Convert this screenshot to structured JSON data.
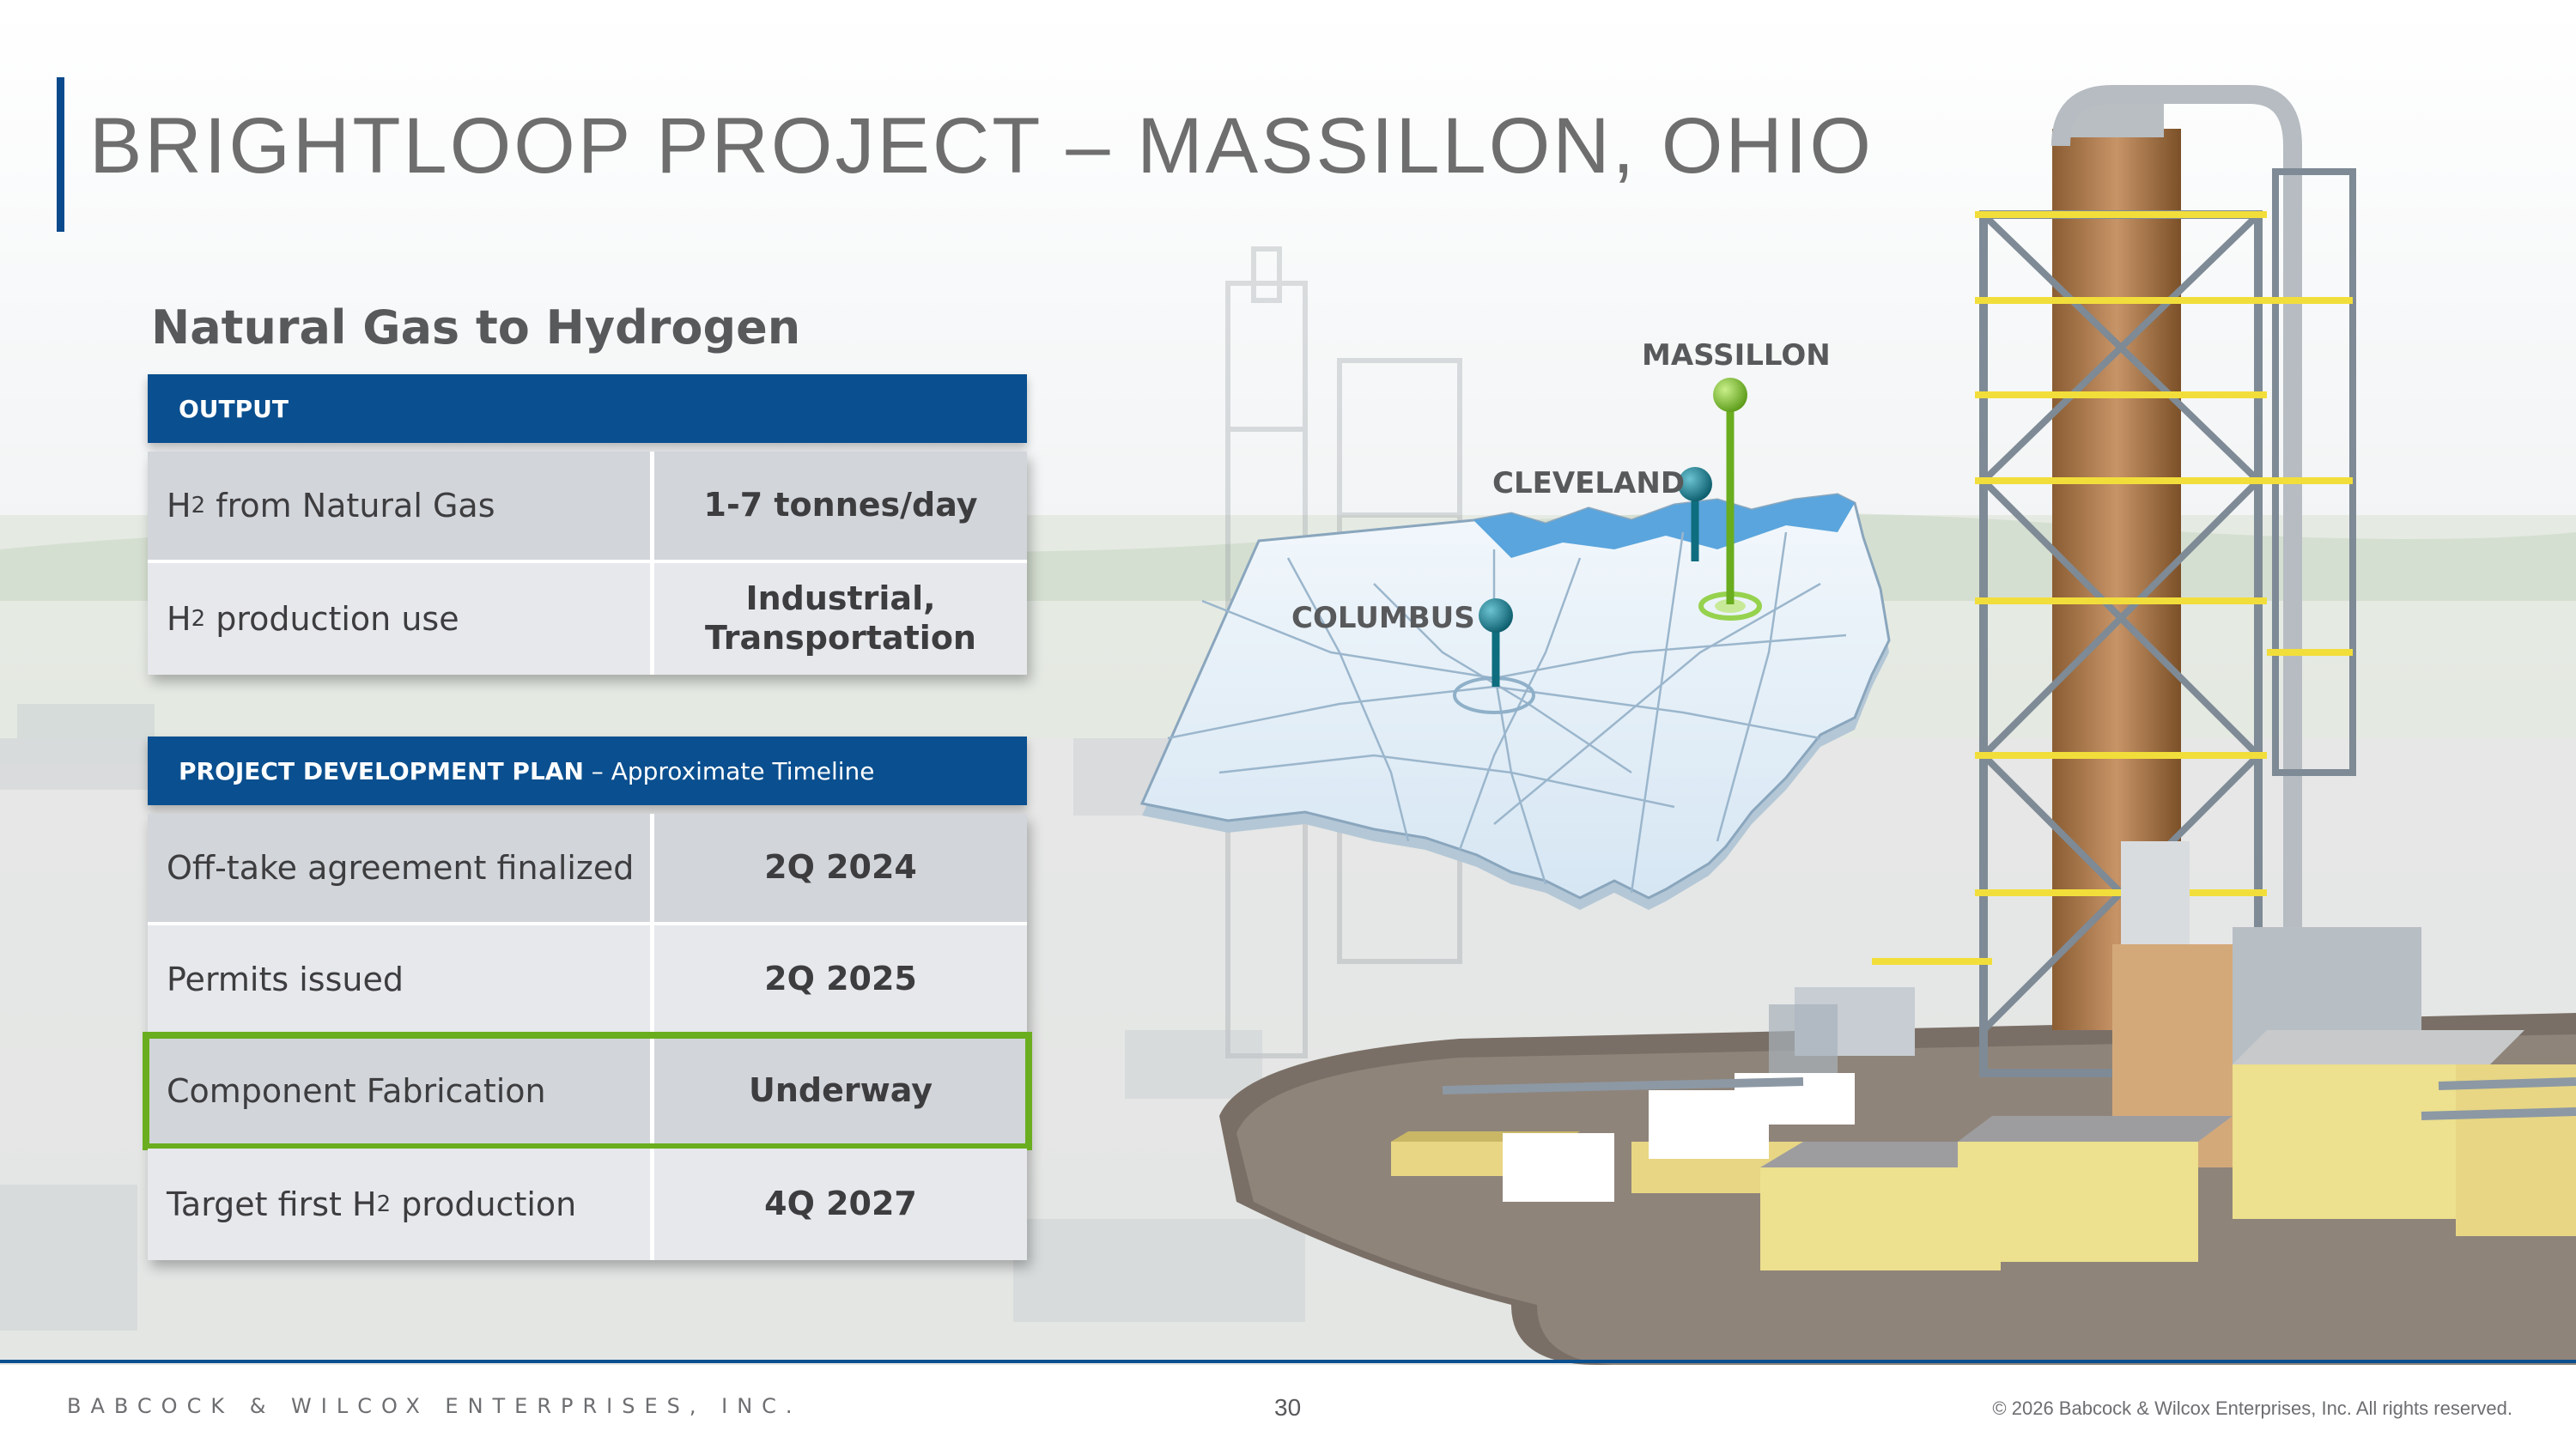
{
  "title": "BRIGHTLOOP PROJECT – MASSILLON, OHIO",
  "subtitle": "Natural Gas to Hydrogen",
  "output_table": {
    "header": "OUTPUT",
    "rows": [
      {
        "label_pre": "H",
        "label_sub": "2",
        "label_post": " from Natural Gas",
        "value": "1-7 tonnes/day"
      },
      {
        "label_pre": "H",
        "label_sub": "2",
        "label_post": " production use",
        "value": "Industrial, Transportation"
      }
    ]
  },
  "plan_table": {
    "header_bold": "PROJECT DEVELOPMENT PLAN",
    "header_rest": " – Approximate Timeline",
    "rows": [
      {
        "label": "Off-take agreement finalized",
        "value": "2Q 2024"
      },
      {
        "label": "Permits issued",
        "value": "2Q 2025"
      },
      {
        "label": "Component Fabrication",
        "value": "Underway",
        "highlighted": true
      },
      {
        "label_pre": "Target first H",
        "label_sub": "2",
        "label_post": " production",
        "value": "4Q 2027"
      }
    ]
  },
  "map": {
    "cities": [
      "MASSILLON",
      "CLEVELAND",
      "COLUMBUS"
    ],
    "pin_colors": {
      "massillon": "#6aad1f",
      "cleveland": "#0e6d7e",
      "columbus": "#0e6d7e"
    }
  },
  "footer": {
    "company": "BABCOCK & WILCOX ENTERPRISES, INC.",
    "page_number": "30",
    "copyright": "© 2026 Babcock & Wilcox Enterprises, Inc. All rights reserved."
  },
  "colors": {
    "brand_blue": "#0a4f8f",
    "highlight_green": "#6aad1f",
    "title_gray": "#6e6e6e"
  }
}
